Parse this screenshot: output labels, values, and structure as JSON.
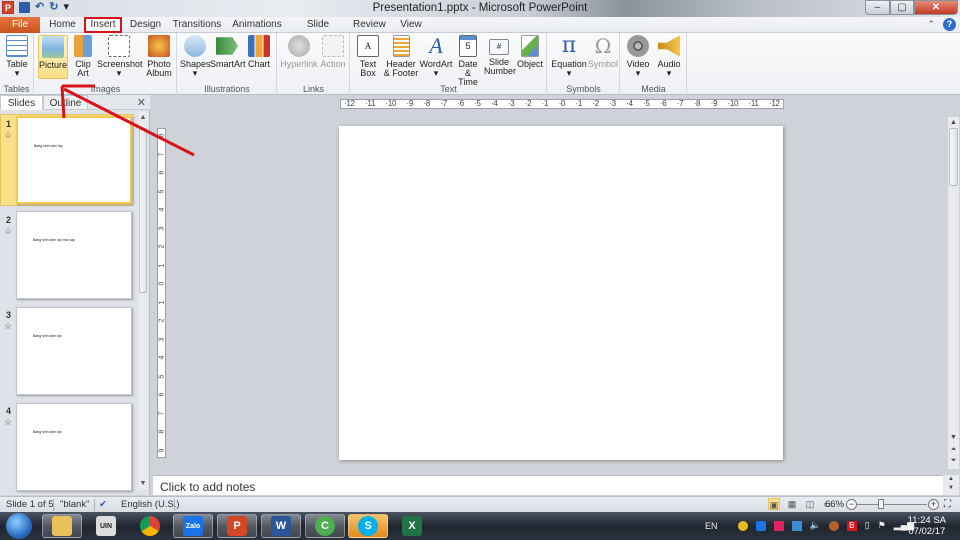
{
  "window": {
    "title": "Presentation1.pptx - Microsoft PowerPoint",
    "controls": {
      "minimize": "–",
      "maximize": "▢",
      "close": "✕"
    }
  },
  "quick_access": {
    "app_icon": "P",
    "undo": "↶",
    "redo": "↻",
    "customize": "▾"
  },
  "tabs": [
    {
      "label": "File"
    },
    {
      "label": "Home"
    },
    {
      "label": "Insert"
    },
    {
      "label": "Design"
    },
    {
      "label": "Transitions"
    },
    {
      "label": "Animations"
    },
    {
      "label": "Slide Show"
    },
    {
      "label": "Review"
    },
    {
      "label": "View"
    }
  ],
  "active_tab": "Insert",
  "help": "?",
  "ribbon": {
    "groups": [
      {
        "label": "Tables",
        "buttons": [
          {
            "label": "Table",
            "dropdown": "▾"
          }
        ]
      },
      {
        "label": "Images",
        "buttons": [
          {
            "label": "Picture"
          },
          {
            "label": "Clip Art"
          },
          {
            "label": "Screenshot",
            "dropdown": "▾"
          },
          {
            "label": "Photo Album",
            "dropdown": "▾"
          }
        ]
      },
      {
        "label": "Illustrations",
        "buttons": [
          {
            "label": "Shapes",
            "dropdown": "▾"
          },
          {
            "label": "SmartArt"
          },
          {
            "label": "Chart"
          }
        ]
      },
      {
        "label": "Links",
        "buttons": [
          {
            "label": "Hyperlink"
          },
          {
            "label": "Action"
          }
        ]
      },
      {
        "label": "Text",
        "buttons": [
          {
            "label": "Text Box"
          },
          {
            "label": "Header & Footer"
          },
          {
            "label": "WordArt",
            "dropdown": "▾"
          },
          {
            "label": "Date & Time"
          },
          {
            "label": "Slide Number"
          },
          {
            "label": "Object"
          }
        ]
      },
      {
        "label": "Symbols",
        "buttons": [
          {
            "label": "Equation",
            "dropdown": "▾"
          },
          {
            "label": "Symbol"
          }
        ]
      },
      {
        "label": "Media",
        "buttons": [
          {
            "label": "Video",
            "dropdown": "▾"
          },
          {
            "label": "Audio",
            "dropdown": "▾"
          }
        ]
      }
    ]
  },
  "left_pane": {
    "tabs": [
      {
        "label": "Slides"
      },
      {
        "label": "Outline"
      }
    ],
    "close": "✕",
    "slides": [
      {
        "number": "1",
        "text": "Bang sinh vien lop",
        "selected": true
      },
      {
        "number": "2",
        "text": "Bang sinh vien lop moi cap",
        "selected": false
      },
      {
        "number": "3",
        "text": "Bang sinh vien lop",
        "selected": false
      },
      {
        "number": "4",
        "text": "Bang sinh vien lop",
        "selected": false
      }
    ]
  },
  "rulers": {
    "horizontal": [
      "12",
      "11",
      "10",
      "9",
      "8",
      "7",
      "6",
      "5",
      "4",
      "3",
      "2",
      "1",
      "0",
      "1",
      "2",
      "3",
      "4",
      "5",
      "6",
      "7",
      "8",
      "9",
      "10",
      "11",
      "12"
    ],
    "vertical": [
      "8",
      "7",
      "6",
      "5",
      "4",
      "3",
      "2",
      "1",
      "0",
      "1",
      "2",
      "3",
      "4",
      "5",
      "6",
      "7",
      "8",
      "9"
    ]
  },
  "notes": {
    "placeholder": "Click to add notes"
  },
  "status_bar": {
    "slide_info": "Slide 1 of 5",
    "theme": "\"blank\"",
    "language": "English (U.S.)",
    "zoom": "66%",
    "zoom_level_percent": 66
  },
  "taskbar": {
    "apps": [
      {
        "name": "File Explorer",
        "glyph": "📁",
        "color": "#e8c15a"
      },
      {
        "name": "Unikey",
        "glyph": "UIN",
        "color": "#dddddd"
      },
      {
        "name": "Chrome",
        "glyph": "◉",
        "color": "#db4437"
      },
      {
        "name": "Zalo",
        "glyph": "Zalo",
        "color": "#1a73e8"
      },
      {
        "name": "PowerPoint",
        "glyph": "P",
        "color": "#d24726"
      },
      {
        "name": "Word",
        "glyph": "W",
        "color": "#2b579a"
      },
      {
        "name": "Coc Coc",
        "glyph": "C",
        "color": "#4caf50"
      },
      {
        "name": "Skype",
        "glyph": "S",
        "color": "#00aff0"
      },
      {
        "name": "Excel",
        "glyph": "X",
        "color": "#217346"
      }
    ],
    "tray": {
      "lang": "EN",
      "time": "11:24 SA",
      "date": "07/02/17"
    }
  },
  "colors": {
    "accent_file": "#d24726",
    "highlight": "#d8131c",
    "selected": "#fbe08a"
  }
}
